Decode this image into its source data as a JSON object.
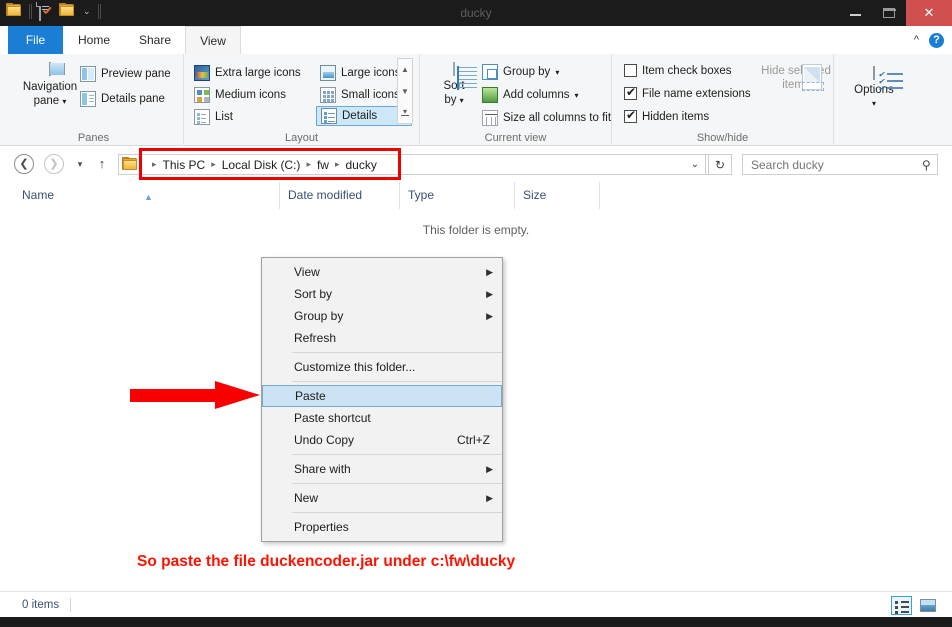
{
  "window": {
    "title": "ducky",
    "quick_access": [
      {
        "name": "folder-icon",
        "label": "Folder"
      },
      {
        "name": "properties-icon",
        "label": "Properties"
      },
      {
        "name": "new-folder-icon",
        "label": "New folder"
      },
      {
        "name": "customize-quick-access-caret",
        "label": "Customize Quick Access Toolbar"
      }
    ],
    "controls": {
      "minimize": "Minimize",
      "maximize": "Maximize",
      "close": "✕",
      "close_color": "#d05050"
    }
  },
  "ribbon": {
    "tabs": [
      {
        "label": "File",
        "active": false,
        "accent": "#1a7fd4"
      },
      {
        "label": "Home",
        "active": false
      },
      {
        "label": "Share",
        "active": false
      },
      {
        "label": "View",
        "active": true
      }
    ],
    "collapse_label": "^",
    "help_label": "?",
    "groups": {
      "panes": {
        "title": "Panes",
        "navigation_pane": "Navigation\npane",
        "navigation_pane_line1": "Navigation",
        "navigation_pane_line2": "pane",
        "preview_pane": "Preview pane",
        "details_pane": "Details pane"
      },
      "layout": {
        "title": "Layout",
        "items": [
          {
            "label": "Extra large icons",
            "selected": false
          },
          {
            "label": "Large icons",
            "selected": false
          },
          {
            "label": "Medium icons",
            "selected": false
          },
          {
            "label": "Small icons",
            "selected": false
          },
          {
            "label": "List",
            "selected": false
          },
          {
            "label": "Details",
            "selected": true
          }
        ]
      },
      "current_view": {
        "title": "Current view",
        "sort_by_line1": "Sort",
        "sort_by_line2": "by",
        "group_by": "Group by",
        "add_columns": "Add columns",
        "size_all_columns": "Size all columns to fit"
      },
      "show_hide": {
        "title": "Show/hide",
        "item_check_boxes": {
          "label": "Item check boxes",
          "checked": false
        },
        "file_name_extensions": {
          "label": "File name extensions",
          "checked": true
        },
        "hidden_items": {
          "label": "Hidden items",
          "checked": true
        },
        "hide_selected_line1": "Hide selected",
        "hide_selected_line2": "items"
      },
      "options": {
        "title": "",
        "label": "Options"
      }
    }
  },
  "addressbar": {
    "back": "❮",
    "forward": "❯",
    "recent": "⌄",
    "up": "↑",
    "breadcrumbs": [
      "This PC",
      "Local Disk (C:)",
      "fw",
      "ducky"
    ],
    "separator": "▸",
    "dropdown": "⌄",
    "refresh": "↻",
    "highlight_color": "#ee0000",
    "search": {
      "placeholder": "Search ducky",
      "value": ""
    }
  },
  "columns": [
    {
      "label": "Name",
      "sorted": "asc"
    },
    {
      "label": "Date modified",
      "sorted": ""
    },
    {
      "label": "Type",
      "sorted": ""
    },
    {
      "label": "Size",
      "sorted": ""
    }
  ],
  "content": {
    "empty_message": "This folder is empty."
  },
  "context_menu": {
    "items": [
      {
        "label": "View",
        "submenu": true,
        "selected": false,
        "accel": ""
      },
      {
        "label": "Sort by",
        "submenu": true,
        "selected": false,
        "accel": ""
      },
      {
        "label": "Group by",
        "submenu": true,
        "selected": false,
        "accel": ""
      },
      {
        "label": "Refresh",
        "submenu": false,
        "selected": false,
        "accel": ""
      },
      {
        "label": "Customize this folder...",
        "submenu": false,
        "selected": false,
        "accel": ""
      },
      {
        "label": "Paste",
        "submenu": false,
        "selected": true,
        "accel": ""
      },
      {
        "label": "Paste shortcut",
        "submenu": false,
        "selected": false,
        "accel": ""
      },
      {
        "label": "Undo Copy",
        "submenu": false,
        "selected": false,
        "accel": "Ctrl+Z"
      },
      {
        "label": "Share with",
        "submenu": true,
        "selected": false,
        "accel": ""
      },
      {
        "label": "New",
        "submenu": true,
        "selected": false,
        "accel": ""
      },
      {
        "label": "Properties",
        "submenu": false,
        "selected": false,
        "accel": ""
      }
    ],
    "submenu_glyph": "▶"
  },
  "annotation": {
    "text": "So paste the file duckencoder.jar under c:\\fw\\ducky",
    "color": "#ff1200",
    "arrow_color": "#fb0000"
  },
  "statusbar": {
    "item_count": "0 items",
    "view_details": "Details view",
    "view_large_icons": "Large icons view"
  }
}
